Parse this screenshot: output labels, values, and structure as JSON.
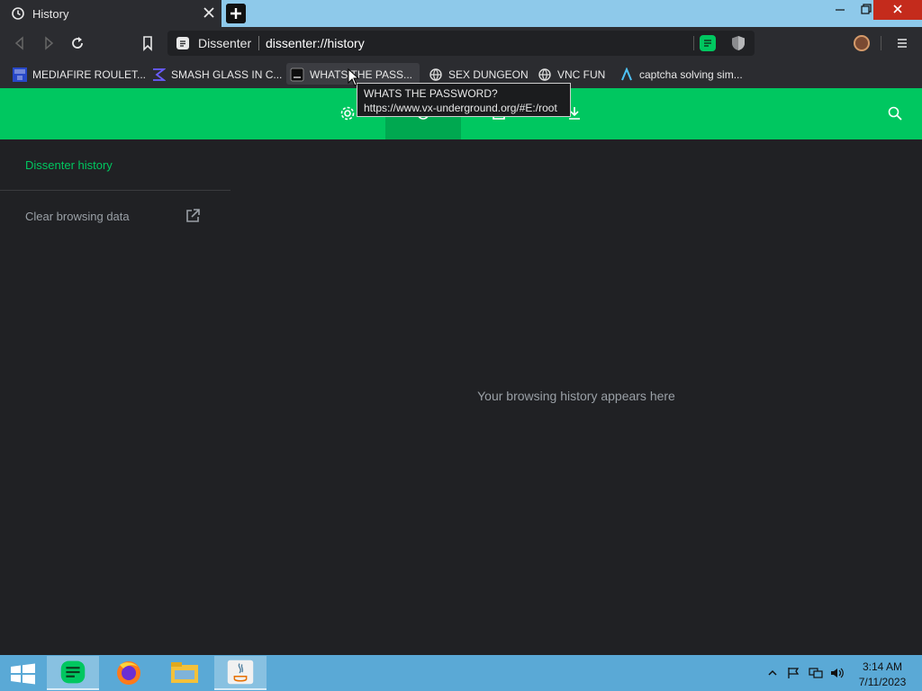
{
  "browser": {
    "tab": {
      "title": "History",
      "icon": "history-icon"
    },
    "window_controls": [
      "minimize",
      "maximize",
      "close"
    ],
    "omnibox": {
      "site": "Dissenter",
      "url": "dissenter://history"
    },
    "bookmarks": [
      {
        "label": "MEDIAFIRE ROULET...",
        "icon": "mediafire-icon"
      },
      {
        "label": "SMASH GLASS IN C...",
        "icon": "smash-glass-icon"
      },
      {
        "label": "WHATS THE PASS...",
        "icon": "terminal-icon"
      },
      {
        "label": "SEX DUNGEON",
        "icon": "globe-icon"
      },
      {
        "label": "VNC FUN",
        "icon": "globe-icon"
      },
      {
        "label": "captcha solving sim...",
        "icon": "captcha-icon"
      }
    ],
    "tooltip": {
      "title": "WHATS THE PASSWORD?",
      "url": "https://www.vx-underground.org/#E:/root"
    }
  },
  "page": {
    "sidebar": {
      "active_item": "Dissenter history",
      "clear_item": "Clear browsing data"
    },
    "empty_message": "Your browsing history appears here"
  },
  "colors": {
    "accent": "#00c760",
    "background": "#202124",
    "taskbar": "#5aa9d6"
  },
  "taskbar": {
    "apps": [
      "dissenter",
      "firefox",
      "file-explorer",
      "java"
    ],
    "clock": {
      "time": "3:14 AM",
      "date": "7/11/2023"
    }
  }
}
